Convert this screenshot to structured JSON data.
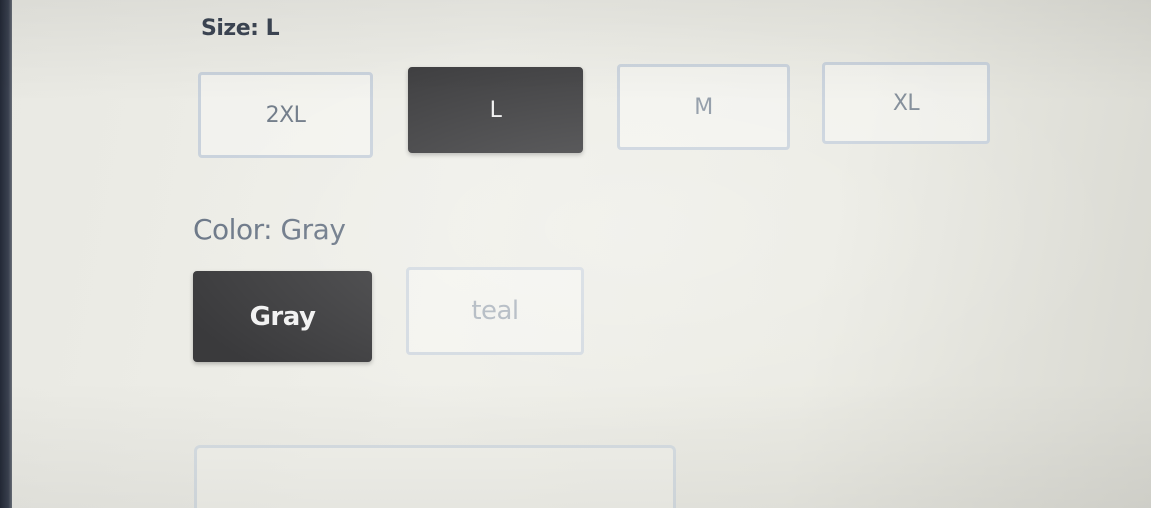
{
  "size": {
    "label": "Size: L",
    "options": [
      {
        "label": "2XL",
        "selected": false
      },
      {
        "label": "L",
        "selected": true
      },
      {
        "label": "M",
        "selected": false
      },
      {
        "label": "XL",
        "selected": false
      }
    ]
  },
  "color": {
    "label": "Color: Gray",
    "options": [
      {
        "label": "Gray",
        "selected": true
      },
      {
        "label": "teal",
        "selected": false
      }
    ]
  },
  "colors": {
    "selected_bg": "#3a3a3c",
    "option_border": "#c9d2dc",
    "label_text": "#3d4654"
  }
}
